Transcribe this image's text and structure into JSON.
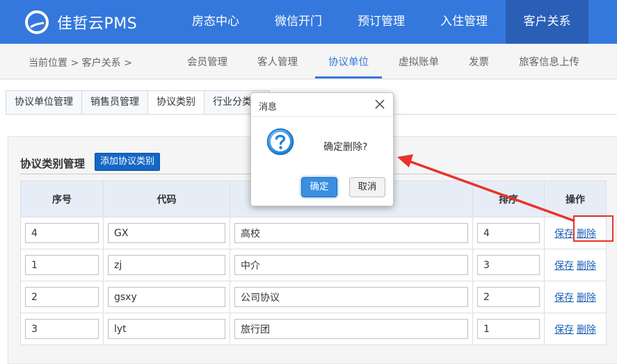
{
  "brand": {
    "name": "佳哲云PMS"
  },
  "top_nav": [
    "房态中心",
    "微信开门",
    "预订管理",
    "入住管理",
    "客户关系"
  ],
  "breadcrumb": "当前位置 > 客户关系 >",
  "sub_nav": [
    "会员管理",
    "客人管理",
    "协议单位",
    "虚拟账单",
    "发票",
    "旅客信息上传"
  ],
  "tabs": [
    "协议单位管理",
    "销售员管理",
    "协议类别",
    "行业分类"
  ],
  "panel": {
    "title": "协议类别管理",
    "add_button": "添加协议类别"
  },
  "table": {
    "headers": [
      "序号",
      "代码",
      "",
      "排序",
      "操作"
    ],
    "rows": [
      {
        "index": "4",
        "code": "GX",
        "name": "高校",
        "sort": "4"
      },
      {
        "index": "1",
        "code": "zj",
        "name": "中介",
        "sort": "3"
      },
      {
        "index": "2",
        "code": "gsxy",
        "name": "公司协议",
        "sort": "2"
      },
      {
        "index": "3",
        "code": "lyt",
        "name": "旅行团",
        "sort": "1"
      }
    ],
    "save_label": "保存",
    "delete_label": "删除"
  },
  "dialog": {
    "title": "消息",
    "message": "确定删除?",
    "ok": "确定",
    "cancel": "取消"
  },
  "colors": {
    "primary": "#3478dd",
    "active_nav": "#2a5fb7",
    "annotation": "#e8332a"
  }
}
